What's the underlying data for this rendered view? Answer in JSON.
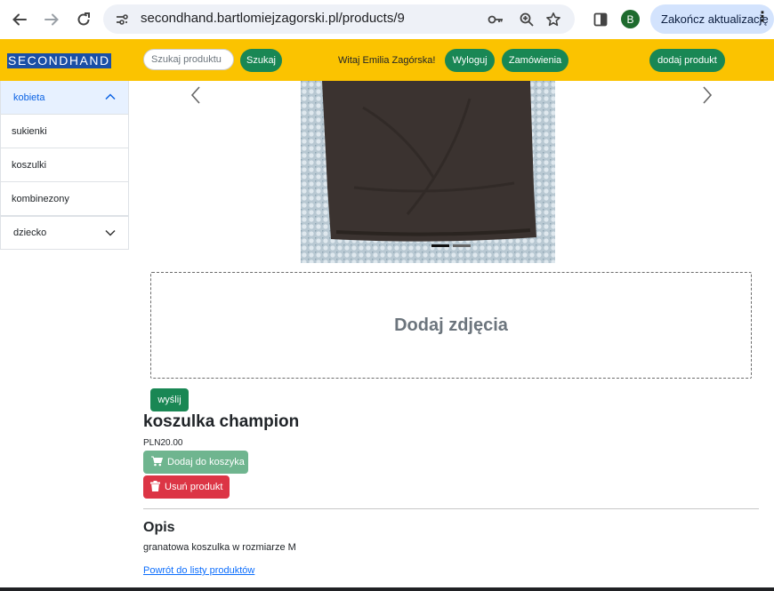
{
  "browser": {
    "url": "secondhand.bartlomiejzagorski.pl/products/9",
    "profile_initial": "B",
    "update_label": "Zakończ aktualizację"
  },
  "header": {
    "brand": "SECONDHAND",
    "search_placeholder": "Szukaj produktu",
    "search_button": "Szukaj",
    "welcome": "Witaj Emilia Zagórska!",
    "logout": "Wyloguj",
    "orders": "Zamówienia",
    "add_product": "dodaj produkt",
    "accent_color": "#fbc300",
    "button_color": "#198754"
  },
  "sidebar": {
    "active_group": "kobieta",
    "items": [
      "sukienki",
      "koszulki",
      "kombinezony"
    ],
    "collapsed_group": "dziecko"
  },
  "carousel": {
    "slides": 2,
    "active_slide": 1
  },
  "dropzone": {
    "label": "Dodaj zdjęcia"
  },
  "upload_button": "wyślij",
  "product": {
    "title": "koszulka champion",
    "price": "PLN20.00",
    "add_to_cart": "Dodaj do koszyka",
    "delete": "Usuń produkt"
  },
  "description": {
    "heading": "Opis",
    "text": "granatowa koszulka w rozmiarze M"
  },
  "back_link": "Powrót do listy produktów"
}
